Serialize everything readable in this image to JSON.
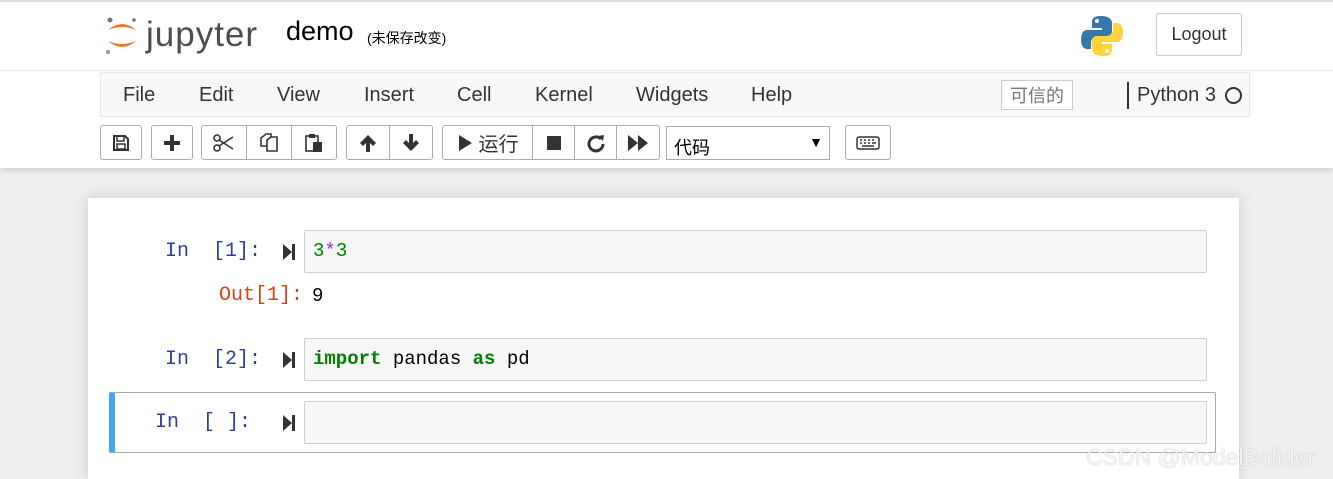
{
  "header": {
    "logo_text": "jupyter",
    "notebook_name": "demo",
    "save_status": "(未保存改变)",
    "logout_label": "Logout"
  },
  "menubar": {
    "items": [
      "File",
      "Edit",
      "View",
      "Insert",
      "Cell",
      "Kernel",
      "Widgets",
      "Help"
    ],
    "trusted_label": "可信的",
    "kernel_name": "Python 3"
  },
  "toolbar": {
    "buttons": [
      "save-icon",
      "plus-icon",
      "scissors-icon",
      "copy-icon",
      "paste-icon",
      "arrow-up-icon",
      "arrow-down-icon",
      "play-icon",
      "stop-icon",
      "restart-icon",
      "fast-forward-icon",
      "keyboard-icon"
    ],
    "run_label": "运行",
    "cell_type": "代码"
  },
  "cells": [
    {
      "prompt": "In  [1]:",
      "code": {
        "left": "3",
        "op": "*",
        "right": "3"
      },
      "output_prompt": "Out[1]:",
      "output": "9"
    },
    {
      "prompt": "In  [2]:",
      "code": {
        "kw1": "import",
        "mod": " pandas ",
        "kw2": "as",
        "alias": " pd"
      }
    },
    {
      "prompt": "In  [ ]:",
      "code": {},
      "selected": true
    }
  ],
  "watermark": "CSDN @ModelBulider",
  "colors": {
    "in_prompt": "#303f9f",
    "out_prompt": "#d84315",
    "selected_cell_accent": "#42a5f5",
    "keyword": "#008000"
  }
}
